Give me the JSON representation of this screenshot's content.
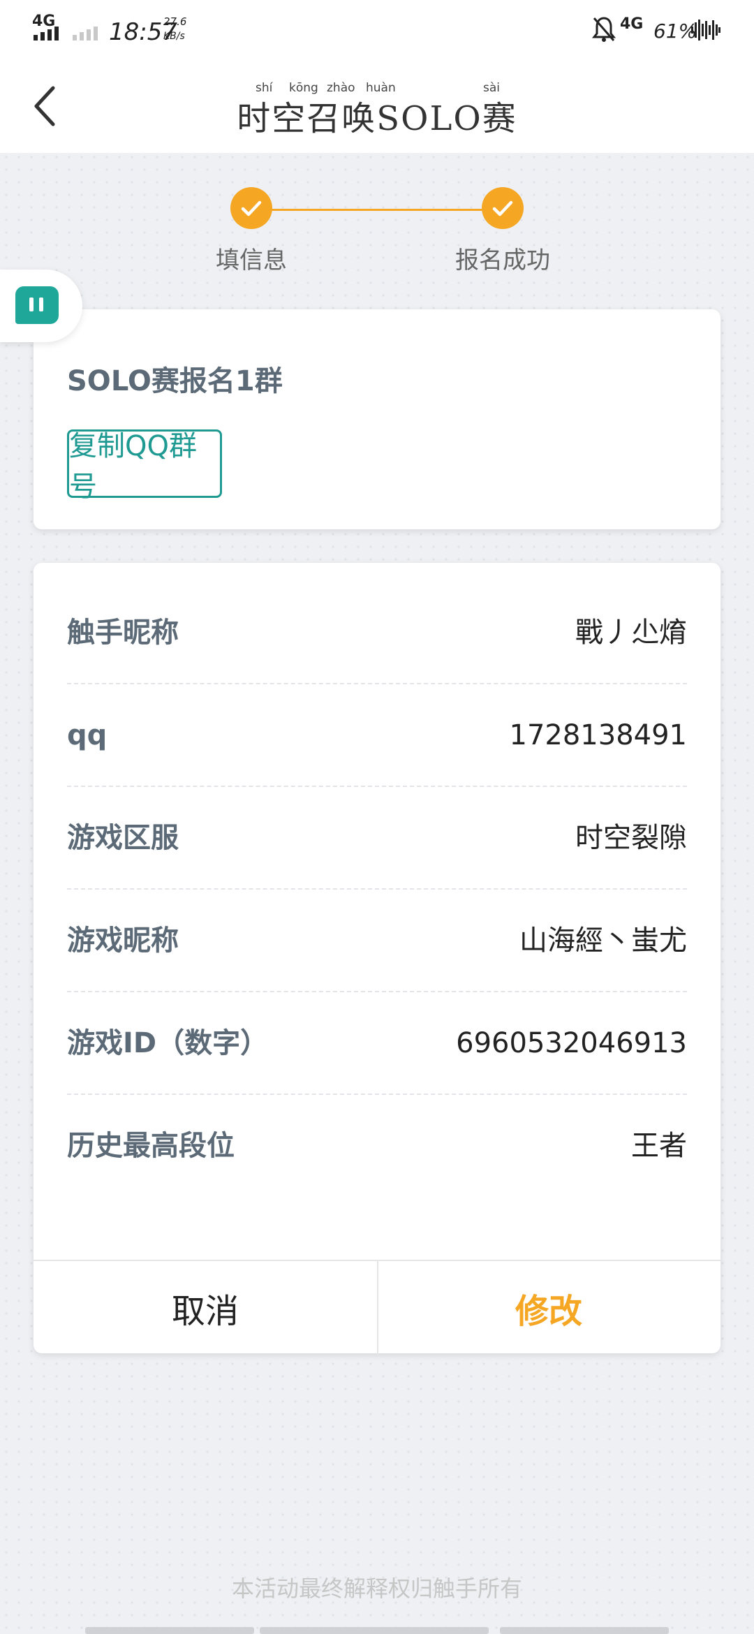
{
  "status_bar": {
    "network_left": "4G",
    "time": "18:57",
    "speed_value": "27.6",
    "speed_unit": "KB/s",
    "network_right": "4G",
    "battery": "61%"
  },
  "header": {
    "title": "时空召唤SOLO赛",
    "pinyin": [
      "shí",
      "kōng",
      "zhào",
      "huàn",
      "sài"
    ]
  },
  "steps": [
    {
      "label": "填信息",
      "done": true
    },
    {
      "label": "报名成功",
      "done": true
    }
  ],
  "group_card": {
    "name": "SOLO赛报名1群",
    "copy_button": "复制QQ群号"
  },
  "info": {
    "rows": [
      {
        "label": "触手昵称",
        "value": "戰丿尐焴"
      },
      {
        "label": "qq",
        "value": "1728138491"
      },
      {
        "label": "游戏区服",
        "value": "时空裂隙"
      },
      {
        "label": "游戏昵称",
        "value": "山海經丶蚩尤"
      },
      {
        "label": "游戏ID（数字）",
        "value": "6960532046913"
      },
      {
        "label": "历史最高段位",
        "value": "王者"
      }
    ]
  },
  "actions": {
    "cancel": "取消",
    "edit": "修改"
  },
  "footer": "本活动最终解释权归触手所有",
  "colors": {
    "accent": "#f5a623",
    "teal": "#1f9a92",
    "label": "#5b6a76"
  }
}
